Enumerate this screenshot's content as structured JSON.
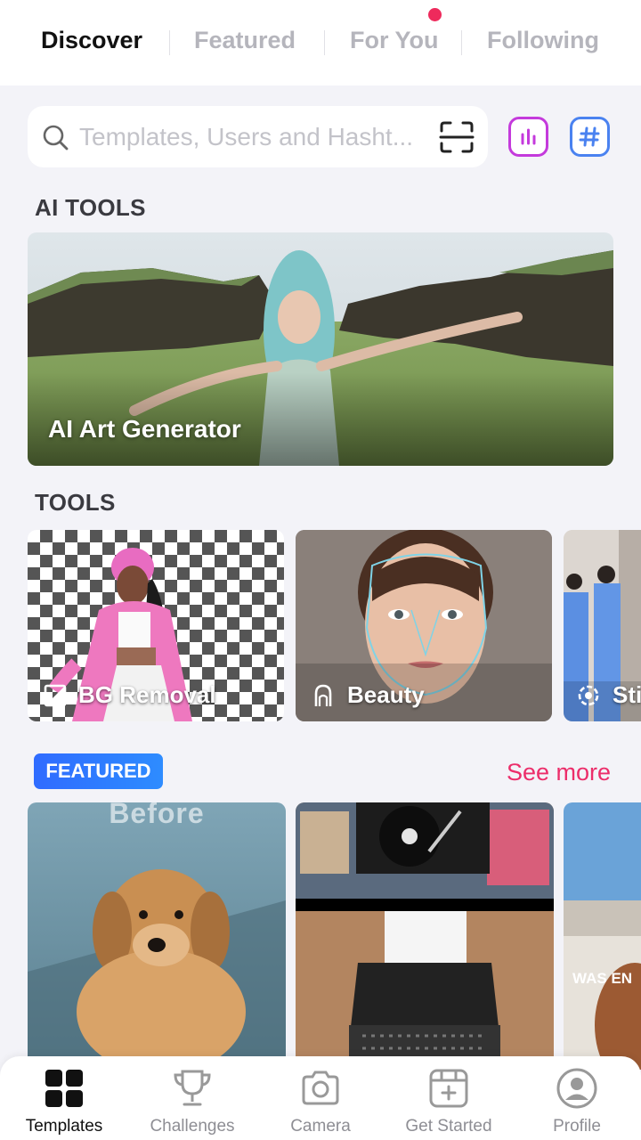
{
  "top_tabs": [
    {
      "label": "Discover",
      "active": true
    },
    {
      "label": "Featured",
      "active": false
    },
    {
      "label": "For You",
      "active": false,
      "has_notification": true
    },
    {
      "label": "Following",
      "active": false
    }
  ],
  "search": {
    "placeholder": "Templates, Users and Hasht..."
  },
  "sections": {
    "ai_tools": "AI TOOLS",
    "tools": "TOOLS"
  },
  "ai_tool": {
    "label": "AI Art Generator"
  },
  "tools": [
    {
      "label": "BG Removal",
      "icon": "bg-removal-icon"
    },
    {
      "label": "Beauty",
      "icon": "beauty-icon"
    },
    {
      "label": "Sti",
      "icon": "sticker-icon"
    }
  ],
  "featured": {
    "badge": "FEATURED",
    "see_more": "See more",
    "cards": [
      {
        "overlay_text": "Before"
      },
      {
        "overlay_text": ""
      },
      {
        "overlay_text": "WAS EN"
      }
    ]
  },
  "bottom_nav": [
    {
      "label": "Templates",
      "icon": "grid-icon",
      "active": true
    },
    {
      "label": "Challenges",
      "icon": "trophy-icon",
      "active": false
    },
    {
      "label": "Camera",
      "icon": "camera-icon",
      "active": false
    },
    {
      "label": "Get Started",
      "icon": "calendar-plus-icon",
      "active": false
    },
    {
      "label": "Profile",
      "icon": "profile-icon",
      "active": false
    }
  ],
  "colors": {
    "accent_pink": "#ec2d6a",
    "badge_blue": "#2f6bff",
    "stats_purple": "#c43adc",
    "hash_blue": "#4a82f0"
  }
}
